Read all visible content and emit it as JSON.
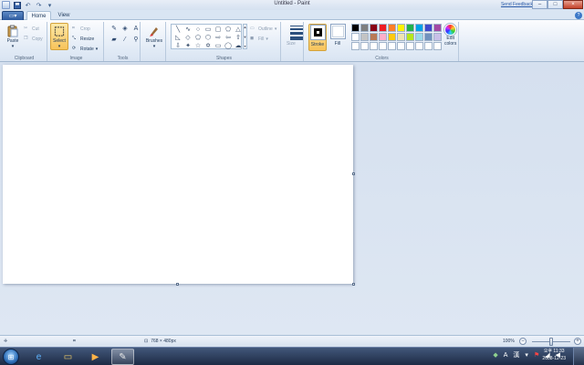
{
  "window": {
    "title": "Untitled - Paint",
    "feedback_link": "Send Feedback",
    "controls": {
      "minimize": "–",
      "maximize": "□",
      "close": "×"
    }
  },
  "quick_access": {
    "icons": [
      "app-menu-icon",
      "save-icon",
      "undo-icon",
      "redo-icon",
      "customize-icon"
    ],
    "undo_glyph": "↶",
    "redo_glyph": "↷",
    "dropdown_glyph": "▾"
  },
  "tabs": {
    "menu_label": "▭▾",
    "home": "Home",
    "view": "View",
    "help": "?"
  },
  "ribbon": {
    "clipboard": {
      "label": "Clipboard",
      "paste": "Paste",
      "cut": "Cut",
      "copy": "Copy"
    },
    "image": {
      "label": "Image",
      "select": "Select",
      "crop": "Crop",
      "resize": "Resize",
      "rotate": "Rotate"
    },
    "tools": {
      "label": "Tools",
      "items": [
        {
          "name": "pencil-icon",
          "glyph": "✎"
        },
        {
          "name": "fill-bucket-icon",
          "glyph": "◈"
        },
        {
          "name": "text-icon",
          "glyph": "A"
        },
        {
          "name": "eraser-icon",
          "glyph": "▰"
        },
        {
          "name": "color-picker-icon",
          "glyph": "⁄"
        },
        {
          "name": "magnifier-icon",
          "glyph": "⚲"
        }
      ]
    },
    "brushes": {
      "label": "Brushes"
    },
    "shapes": {
      "label": "Shapes",
      "outline": "Outline",
      "fill": "Fill",
      "items": [
        {
          "name": "line-shape-icon",
          "glyph": "╲"
        },
        {
          "name": "curve-shape-icon",
          "glyph": "∿"
        },
        {
          "name": "oval-shape-icon",
          "glyph": "○"
        },
        {
          "name": "rectangle-shape-icon",
          "glyph": "▭"
        },
        {
          "name": "rounded-rectangle-shape-icon",
          "glyph": "▢"
        },
        {
          "name": "polygon-shape-icon",
          "glyph": "⬠"
        },
        {
          "name": "triangle-shape-icon",
          "glyph": "△"
        },
        {
          "name": "right-triangle-shape-icon",
          "glyph": "◺"
        },
        {
          "name": "diamond-shape-icon",
          "glyph": "◇"
        },
        {
          "name": "pentagon-shape-icon",
          "glyph": "⬠"
        },
        {
          "name": "hexagon-shape-icon",
          "glyph": "⬡"
        },
        {
          "name": "right-arrow-shape-icon",
          "glyph": "⇨"
        },
        {
          "name": "left-arrow-shape-icon",
          "glyph": "⇦"
        },
        {
          "name": "up-arrow-shape-icon",
          "glyph": "⇧"
        },
        {
          "name": "down-arrow-shape-icon",
          "glyph": "⇩"
        },
        {
          "name": "four-point-star-shape-icon",
          "glyph": "✦"
        },
        {
          "name": "five-point-star-shape-icon",
          "glyph": "☆"
        },
        {
          "name": "six-point-star-shape-icon",
          "glyph": "✡"
        },
        {
          "name": "rounded-callout-shape-icon",
          "glyph": "▭"
        },
        {
          "name": "oval-callout-shape-icon",
          "glyph": "◯"
        },
        {
          "name": "cloud-callout-shape-icon",
          "glyph": "☁"
        }
      ]
    },
    "size": {
      "label": "Size"
    },
    "colors": {
      "label": "Colors",
      "stroke": "Stroke",
      "fill": "Fill",
      "stroke_color": "#000000",
      "fill_color": "#ffffff",
      "edit_colors_line1": "Edit",
      "edit_colors_line2": "colors",
      "palette": [
        "#000000",
        "#7f7f7f",
        "#880015",
        "#ed1c24",
        "#ff7f27",
        "#fff200",
        "#22b14c",
        "#00a2e8",
        "#3f48cc",
        "#a349a4",
        "#ffffff",
        "#c3c3c3",
        "#b97a57",
        "#ffaec9",
        "#ffc90e",
        "#efe4b0",
        "#b5e61d",
        "#99d9ea",
        "#7092be",
        "#c8bfe7",
        "#ffffff",
        "#ffffff",
        "#ffffff",
        "#ffffff",
        "#ffffff",
        "#ffffff",
        "#ffffff",
        "#ffffff",
        "#ffffff",
        "#ffffff"
      ]
    }
  },
  "statusbar": {
    "image_size": "768 × 480px",
    "zoom": "100%"
  },
  "taskbar": {
    "start_glyph": "⊞",
    "apps": [
      {
        "name": "internet-explorer-icon",
        "glyph": "e",
        "color": "#5fb4ff"
      },
      {
        "name": "explorer-folder-icon",
        "glyph": "▭",
        "color": "#f3cf6a"
      },
      {
        "name": "media-player-icon",
        "glyph": "▶",
        "color": "#ffb347"
      },
      {
        "name": "paint-app-icon",
        "glyph": "✎",
        "color": "#e8e8e8"
      }
    ],
    "tray_lang": "A",
    "tray_ime": "漢",
    "clock_time": "오후 11:33",
    "clock_date": "2008-12-23"
  }
}
